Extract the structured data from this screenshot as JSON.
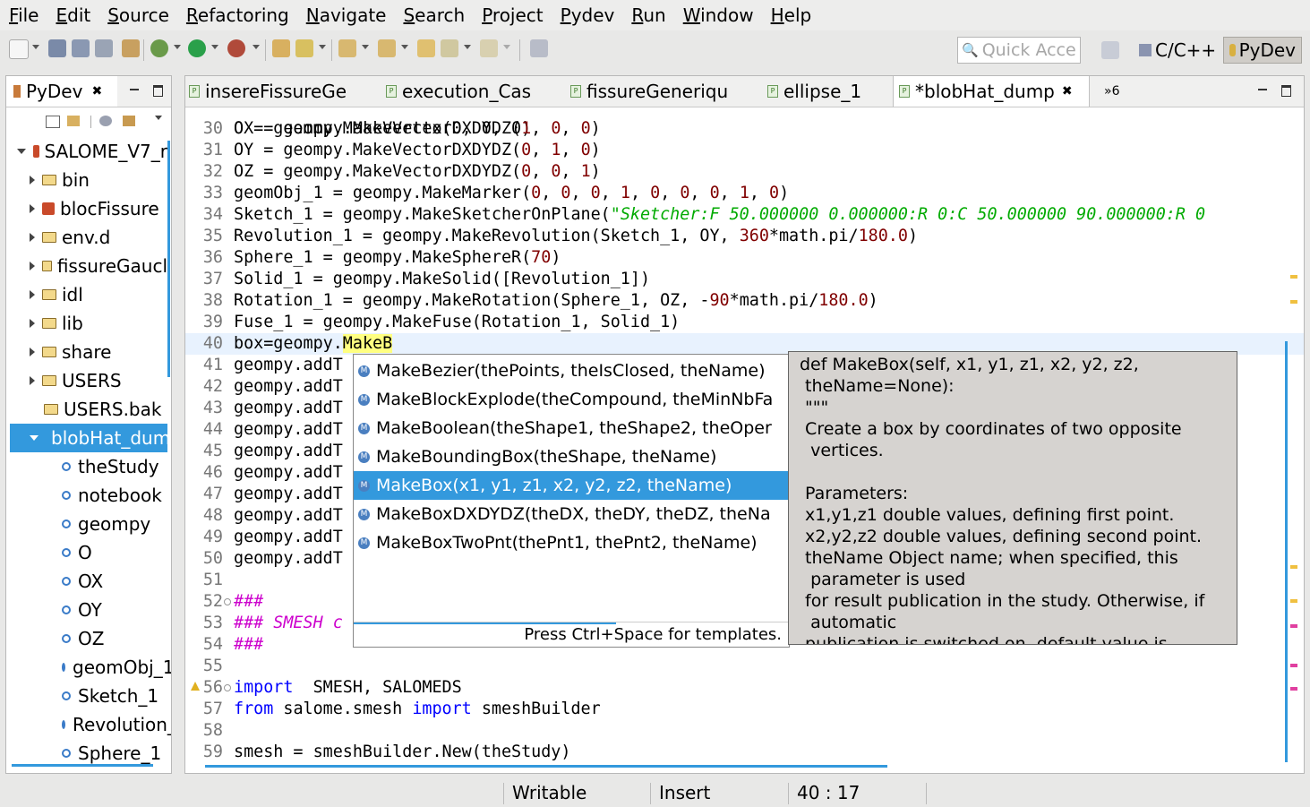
{
  "menubar": {
    "items": [
      "File",
      "Edit",
      "Source",
      "Refactoring",
      "Navigate",
      "Search",
      "Project",
      "Pydev",
      "Run",
      "Window",
      "Help"
    ]
  },
  "toolbar": {
    "quick_access_placeholder": "Quick Acce",
    "perspectives": [
      "C/C++",
      "PyDev"
    ],
    "active_perspective": "PyDev"
  },
  "left_panel": {
    "tab_label": "PyDev",
    "tree": [
      {
        "label": "SALOME_V7_r",
        "kind": "project",
        "expanded": true
      },
      {
        "label": "bin",
        "kind": "folder"
      },
      {
        "label": "blocFissure",
        "kind": "package"
      },
      {
        "label": "env.d",
        "kind": "folder"
      },
      {
        "label": "fissureGaucl",
        "kind": "folder"
      },
      {
        "label": "idl",
        "kind": "folder"
      },
      {
        "label": "lib",
        "kind": "folder"
      },
      {
        "label": "share",
        "kind": "folder"
      },
      {
        "label": "USERS",
        "kind": "folder"
      },
      {
        "label": "USERS.bak",
        "kind": "folder-leaf"
      },
      {
        "label": "blobHat_dum",
        "kind": "file",
        "expanded": true,
        "selected": true
      },
      {
        "label": "theStudy",
        "kind": "attr"
      },
      {
        "label": "notebook",
        "kind": "attr"
      },
      {
        "label": "geompy",
        "kind": "attr"
      },
      {
        "label": "O",
        "kind": "attr"
      },
      {
        "label": "OX",
        "kind": "attr"
      },
      {
        "label": "OY",
        "kind": "attr"
      },
      {
        "label": "OZ",
        "kind": "attr"
      },
      {
        "label": "geomObj_1",
        "kind": "attr"
      },
      {
        "label": "Sketch_1",
        "kind": "attr"
      },
      {
        "label": "Revolution_",
        "kind": "attr"
      },
      {
        "label": "Sphere_1",
        "kind": "attr"
      }
    ]
  },
  "editor": {
    "tabs": [
      {
        "label": "insereFissureGe",
        "active": false
      },
      {
        "label": "execution_Cas",
        "active": false
      },
      {
        "label": "fissureGeneriqu",
        "active": false
      },
      {
        "label": "ellipse_1",
        "active": false
      },
      {
        "label": "*blobHat_dump",
        "active": true
      }
    ],
    "overflow_count": "»6",
    "partial_top_line": "O = geompy.MakeVertex(0, 0, 0)",
    "lines": [
      {
        "n": "30",
        "parts": [
          [
            "OX = geompy.MakeVectorDXDYDZ(",
            ""
          ],
          [
            "1",
            "num"
          ],
          [
            ", ",
            ""
          ],
          [
            "0",
            "num"
          ],
          [
            ", ",
            ""
          ],
          [
            "0",
            "num"
          ],
          [
            ")",
            ""
          ]
        ]
      },
      {
        "n": "31",
        "parts": [
          [
            "OY = geompy.MakeVectorDXDYDZ(",
            ""
          ],
          [
            "0",
            "num"
          ],
          [
            ", ",
            ""
          ],
          [
            "1",
            "num"
          ],
          [
            ", ",
            ""
          ],
          [
            "0",
            "num"
          ],
          [
            ")",
            ""
          ]
        ]
      },
      {
        "n": "32",
        "parts": [
          [
            "OZ = geompy.MakeVectorDXDYDZ(",
            ""
          ],
          [
            "0",
            "num"
          ],
          [
            ", ",
            ""
          ],
          [
            "0",
            "num"
          ],
          [
            ", ",
            ""
          ],
          [
            "1",
            "num"
          ],
          [
            ")",
            ""
          ]
        ]
      },
      {
        "n": "33",
        "parts": [
          [
            "geomObj_1 = geompy.MakeMarker(",
            ""
          ],
          [
            "0",
            "num"
          ],
          [
            ", ",
            ""
          ],
          [
            "0",
            "num"
          ],
          [
            ", ",
            ""
          ],
          [
            "0",
            "num"
          ],
          [
            ", ",
            ""
          ],
          [
            "1",
            "num"
          ],
          [
            ", ",
            ""
          ],
          [
            "0",
            "num"
          ],
          [
            ", ",
            ""
          ],
          [
            "0",
            "num"
          ],
          [
            ", ",
            ""
          ],
          [
            "0",
            "num"
          ],
          [
            ", ",
            ""
          ],
          [
            "1",
            "num"
          ],
          [
            ", ",
            ""
          ],
          [
            "0",
            "num"
          ],
          [
            ")",
            ""
          ]
        ]
      },
      {
        "n": "34",
        "parts": [
          [
            "Sketch_1 = geompy.MakeSketcherOnPlane(",
            ""
          ],
          [
            "\"Sketcher:F 50.000000 0.000000:R 0:C 50.000000 90.000000:R 0",
            "str"
          ]
        ]
      },
      {
        "n": "35",
        "parts": [
          [
            "Revolution_1 = geompy.MakeRevolution(Sketch_1, OY, ",
            ""
          ],
          [
            "360",
            "num"
          ],
          [
            "*math.pi/",
            ""
          ],
          [
            "180.0",
            "num"
          ],
          [
            ")",
            ""
          ]
        ]
      },
      {
        "n": "36",
        "parts": [
          [
            "Sphere_1 = geompy.MakeSphereR(",
            ""
          ],
          [
            "70",
            "num"
          ],
          [
            ")",
            ""
          ]
        ]
      },
      {
        "n": "37",
        "parts": [
          [
            "Solid_1 = geompy.MakeSolid([Revolution_1])",
            ""
          ]
        ]
      },
      {
        "n": "38",
        "parts": [
          [
            "Rotation_1 = geompy.MakeRotation(Sphere_1, OZ, -",
            ""
          ],
          [
            "90",
            "num"
          ],
          [
            "*math.pi/",
            ""
          ],
          [
            "180.0",
            "num"
          ],
          [
            ")",
            ""
          ]
        ]
      },
      {
        "n": "39",
        "parts": [
          [
            "Fuse_1 = geompy.MakeFuse(Rotation_1, Solid_1)",
            ""
          ]
        ]
      },
      {
        "n": "40",
        "parts": [
          [
            "box=geompy.",
            ""
          ],
          [
            "MakeB",
            "hl"
          ]
        ],
        "current": true
      },
      {
        "n": "41",
        "parts": [
          [
            "geompy.addT",
            ""
          ]
        ]
      },
      {
        "n": "42",
        "parts": [
          [
            "geompy.addT",
            ""
          ]
        ]
      },
      {
        "n": "43",
        "parts": [
          [
            "geompy.addT",
            ""
          ]
        ]
      },
      {
        "n": "44",
        "parts": [
          [
            "geompy.addT",
            ""
          ]
        ]
      },
      {
        "n": "45",
        "parts": [
          [
            "geompy.addT",
            ""
          ]
        ]
      },
      {
        "n": "46",
        "parts": [
          [
            "geompy.addT",
            ""
          ]
        ]
      },
      {
        "n": "47",
        "parts": [
          [
            "geompy.addT",
            ""
          ]
        ]
      },
      {
        "n": "48",
        "parts": [
          [
            "geompy.addT",
            ""
          ]
        ]
      },
      {
        "n": "49",
        "parts": [
          [
            "geompy.addT",
            ""
          ]
        ]
      },
      {
        "n": "50",
        "parts": [
          [
            "geompy.addT",
            ""
          ]
        ]
      },
      {
        "n": "51",
        "parts": []
      },
      {
        "n": "52",
        "parts": [
          [
            "###",
            "cm"
          ]
        ],
        "fold": true
      },
      {
        "n": "53",
        "parts": [
          [
            "### SMESH c",
            "cm"
          ]
        ]
      },
      {
        "n": "54",
        "parts": [
          [
            "###",
            "cm"
          ]
        ]
      },
      {
        "n": "55",
        "parts": []
      },
      {
        "n": "56",
        "parts": [
          [
            "import",
            "kw"
          ],
          [
            "  SMESH, SALOMEDS",
            ""
          ]
        ],
        "fold": true,
        "warning": true
      },
      {
        "n": "57",
        "parts": [
          [
            "from",
            "kw"
          ],
          [
            " salome.smesh ",
            ""
          ],
          [
            "import",
            "kw"
          ],
          [
            " smeshBuilder",
            ""
          ]
        ]
      },
      {
        "n": "58",
        "parts": []
      },
      {
        "n": "59",
        "parts": [
          [
            "smesh = smeshBuilder.New(theStudy)",
            ""
          ]
        ]
      }
    ]
  },
  "completion": {
    "items": [
      {
        "label": "MakeBezier(thePoints, theIsClosed, theName)",
        "selected": false
      },
      {
        "label": "MakeBlockExplode(theCompound, theMinNbFa",
        "selected": false
      },
      {
        "label": "MakeBoolean(theShape1, theShape2, theOper",
        "selected": false
      },
      {
        "label": "MakeBoundingBox(theShape, theName)",
        "selected": false
      },
      {
        "label": "MakeBox(x1, y1, z1, x2, y2, z2, theName)",
        "selected": true
      },
      {
        "label": "MakeBoxDXDYDZ(theDX, theDY, theDZ, theNa",
        "selected": false
      },
      {
        "label": "MakeBoxTwoPnt(thePnt1, thePnt2, theName)",
        "selected": false
      }
    ],
    "status": "Press Ctrl+Space for templates.",
    "doc": "def MakeBox(self, x1, y1, z1, x2, y2, z2,\n theName=None):\n \"\"\"\n Create a box by coordinates of two opposite\n  vertices.\n\n Parameters:\n x1,y1,z1 double values, defining first point.\n x2,y2,z2 double values, defining second point.\n theName Object name; when specified, this\n  parameter is used\n for result publication in the study. Otherwise, if\n  automatic\n publication is switched on, default value is"
  },
  "statusbar": {
    "mode": "Writable",
    "insert": "Insert",
    "position": "40 : 17"
  }
}
